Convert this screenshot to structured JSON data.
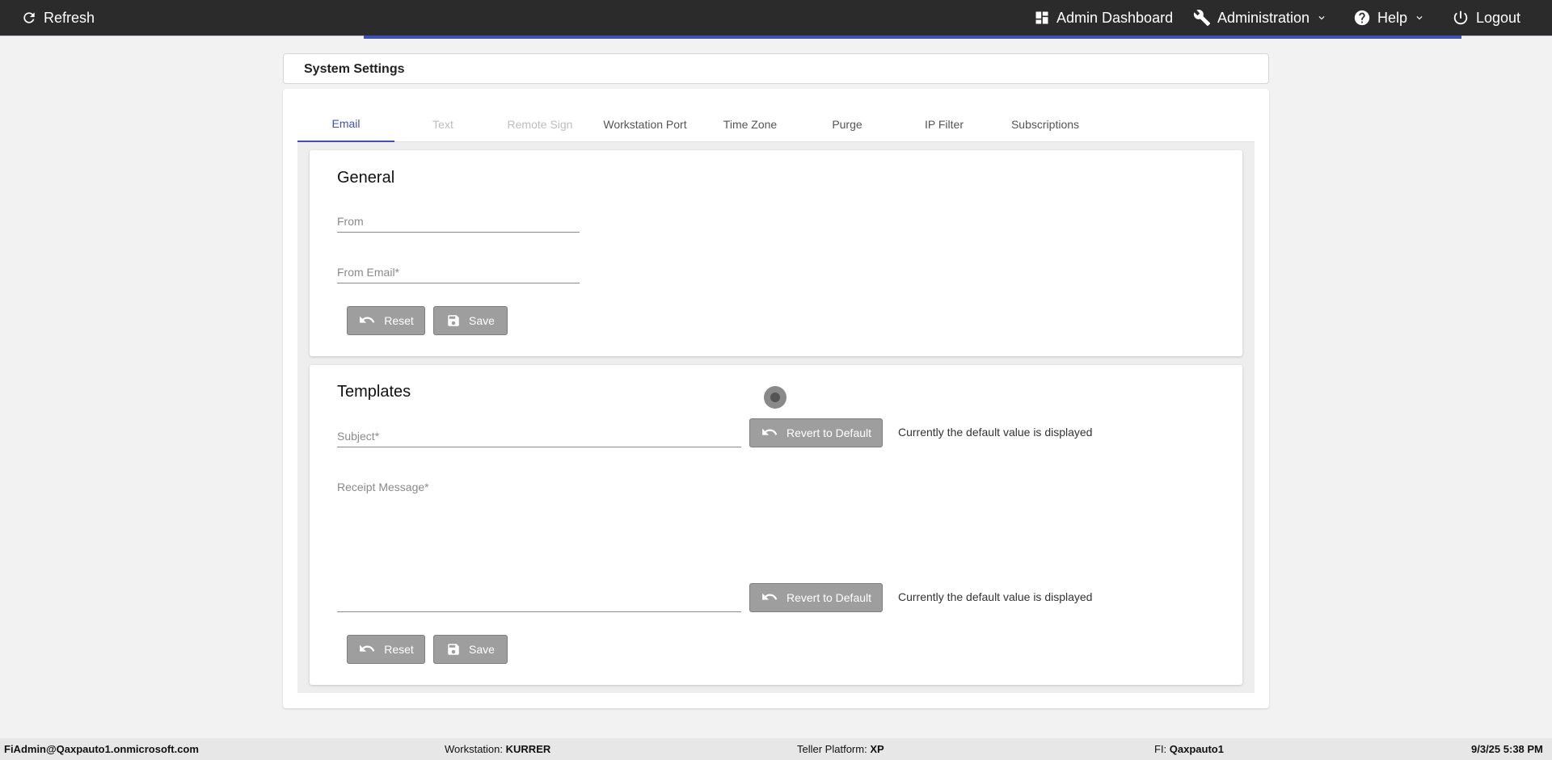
{
  "topbar": {
    "refresh_label": "Refresh",
    "admin_dashboard_label": "Admin Dashboard",
    "administration_label": "Administration",
    "help_label": "Help",
    "logout_label": "Logout"
  },
  "page_title": "System Settings",
  "tabs": [
    {
      "label": "Email",
      "state": "active"
    },
    {
      "label": "Text",
      "state": "disabled"
    },
    {
      "label": "Remote Sign",
      "state": "disabled"
    },
    {
      "label": "Workstation Port",
      "state": "normal"
    },
    {
      "label": "Time Zone",
      "state": "normal"
    },
    {
      "label": "Purge",
      "state": "normal"
    },
    {
      "label": "IP Filter",
      "state": "normal"
    },
    {
      "label": "Subscriptions",
      "state": "normal"
    }
  ],
  "general": {
    "heading": "General",
    "from_placeholder": "From",
    "from_email_placeholder": "From Email*",
    "reset_label": "Reset",
    "save_label": "Save"
  },
  "templates": {
    "heading": "Templates",
    "subject_placeholder": "Subject*",
    "receipt_placeholder": "Receipt Message*",
    "revert_label": "Revert to Default",
    "default_note": "Currently the default value is displayed",
    "reset_label": "Reset",
    "save_label": "Save"
  },
  "statusbar": {
    "user": "FiAdmin@Qaxpauto1.onmicrosoft.com",
    "workstation_label": "Workstation:",
    "workstation_value": "KURRER",
    "teller_label": "Teller Platform:",
    "teller_value": "XP",
    "fi_label": "FI:",
    "fi_value": "Qaxpauto1",
    "datetime": "9/3/25 5:38 PM"
  },
  "colors": {
    "accent": "#3f51b5",
    "topbar": "#2b2b2b",
    "button": "#9e9e9e"
  }
}
